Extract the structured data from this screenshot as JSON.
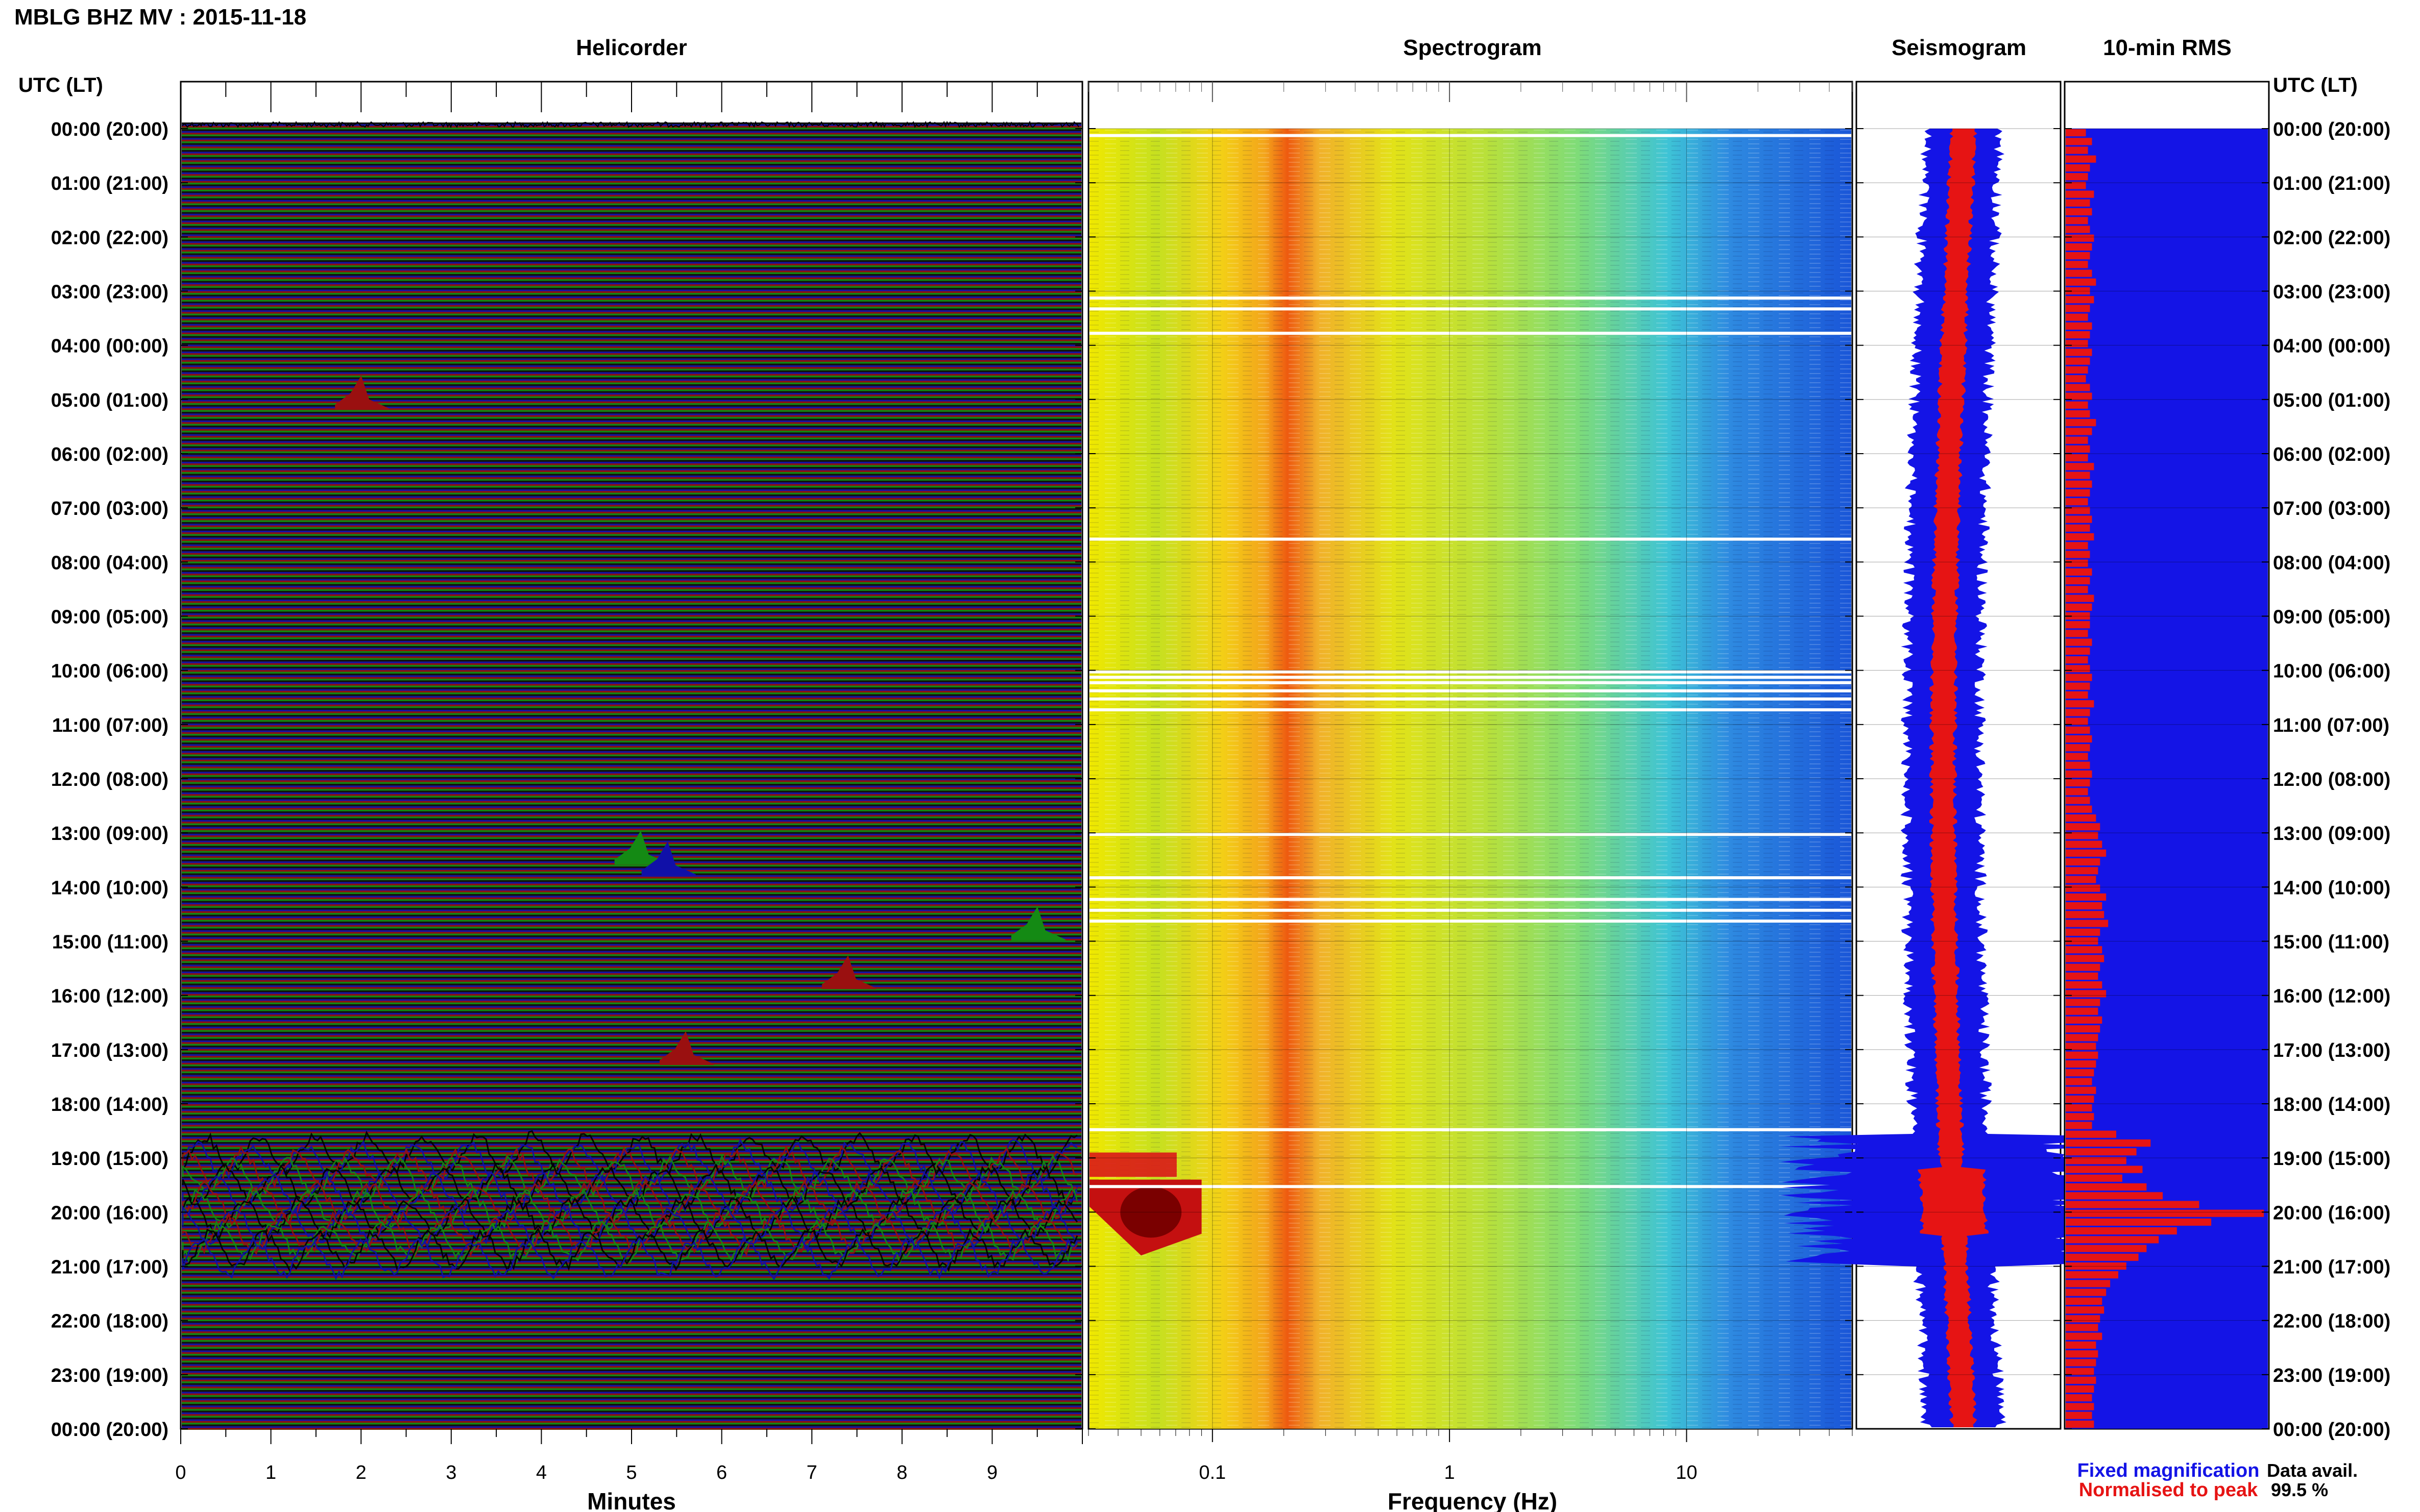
{
  "header": {
    "title": "MBLG BHZ MV : 2015-11-18",
    "axis_label_left": "UTC (LT)",
    "axis_label_right": "UTC (LT)"
  },
  "panels": {
    "helicorder": "Helicorder",
    "spectrogram": "Spectrogram",
    "seismogram": "Seismogram",
    "rms": "10-min RMS"
  },
  "time_labels": [
    "00:00 (20:00)",
    "01:00 (21:00)",
    "02:00 (22:00)",
    "03:00 (23:00)",
    "04:00 (00:00)",
    "05:00 (01:00)",
    "06:00 (02:00)",
    "07:00 (03:00)",
    "08:00 (04:00)",
    "09:00 (05:00)",
    "10:00 (06:00)",
    "11:00 (07:00)",
    "12:00 (08:00)",
    "13:00 (09:00)",
    "14:00 (10:00)",
    "15:00 (11:00)",
    "16:00 (12:00)",
    "17:00 (13:00)",
    "18:00 (14:00)",
    "19:00 (15:00)",
    "20:00 (16:00)",
    "21:00 (17:00)",
    "22:00 (18:00)",
    "23:00 (19:00)",
    "00:00 (20:00)"
  ],
  "legend": {
    "fixed": "Fixed magnification",
    "normalised": "Normalised to peak",
    "fixed_color": "#1414e6",
    "normalised_color": "#e61414"
  },
  "data_avail": {
    "label": "Data avail.",
    "value": "99.5 %"
  },
  "chart_data": [
    {
      "type": "line",
      "title": "Helicorder",
      "xlabel": "Minutes",
      "ylabel": "UTC (LT)",
      "x_ticks": [
        "0",
        "1",
        "2",
        "3",
        "4",
        "5",
        "6",
        "7",
        "8",
        "9"
      ],
      "xlim": [
        0,
        10
      ],
      "ylim_hours": [
        0,
        24
      ],
      "trace_colors": [
        "#000000",
        "#1010a8",
        "#9a1010",
        "#148a14"
      ],
      "events": [
        {
          "hour": 13.5,
          "minute": 5.1,
          "color": "#148a14"
        },
        {
          "hour": 13.7,
          "minute": 5.4,
          "color": "#1010a8"
        },
        {
          "hour": 14.9,
          "minute": 9.5,
          "color": "#148a14"
        },
        {
          "hour": 17.2,
          "minute": 5.6,
          "color": "#9a1010"
        },
        {
          "hour": 5.1,
          "minute": 2.0,
          "color": "#9a1010"
        },
        {
          "hour": 15.8,
          "minute": 7.4,
          "color": "#9a1010"
        }
      ],
      "high_amplitude_hours": [
        18.9,
        21.0
      ]
    },
    {
      "type": "heatmap",
      "title": "Spectrogram",
      "xlabel": "Frequency (Hz)",
      "x_scale": "log",
      "x_ticks": [
        "0.1",
        "1",
        "10"
      ],
      "xlim": [
        0.03,
        50
      ],
      "ylim_hours": [
        0,
        24
      ],
      "peak_frequency_hz": 0.25,
      "low_frequency_burst_hours": [
        18.9,
        20.8
      ]
    },
    {
      "type": "area",
      "title": "Seismogram",
      "series": [
        {
          "name": "Fixed magnification",
          "color": "#1414e6"
        },
        {
          "name": "Normalised to peak",
          "color": "#e61414"
        }
      ],
      "ylim_hours": [
        0,
        24
      ],
      "peak_hour": 19.8
    },
    {
      "type": "bar",
      "title": "10-min RMS",
      "ylim_hours": [
        0,
        24
      ],
      "bin_minutes": 10,
      "rms_relative": [
        0.1,
        0.13,
        0.11,
        0.15,
        0.12,
        0.11,
        0.1,
        0.14,
        0.12,
        0.13,
        0.11,
        0.12,
        0.14,
        0.13,
        0.12,
        0.11,
        0.13,
        0.15,
        0.12,
        0.14,
        0.12,
        0.11,
        0.13,
        0.12,
        0.11,
        0.13,
        0.12,
        0.11,
        0.1,
        0.12,
        0.13,
        0.11,
        0.12,
        0.15,
        0.13,
        0.11,
        0.12,
        0.11,
        0.14,
        0.12,
        0.13,
        0.12,
        0.11,
        0.12,
        0.13,
        0.12,
        0.14,
        0.11,
        0.12,
        0.11,
        0.13,
        0.12,
        0.11,
        0.14,
        0.13,
        0.12,
        0.12,
        0.11,
        0.13,
        0.12,
        0.11,
        0.12,
        0.13,
        0.12,
        0.11,
        0.14,
        0.12,
        0.11,
        0.12,
        0.13,
        0.12,
        0.11,
        0.12,
        0.13,
        0.12,
        0.11,
        0.12,
        0.13,
        0.15,
        0.17,
        0.16,
        0.18,
        0.2,
        0.17,
        0.16,
        0.15,
        0.17,
        0.2,
        0.18,
        0.19,
        0.21,
        0.17,
        0.16,
        0.18,
        0.19,
        0.17,
        0.16,
        0.18,
        0.2,
        0.17,
        0.16,
        0.18,
        0.17,
        0.16,
        0.15,
        0.16,
        0.15,
        0.14,
        0.13,
        0.15,
        0.14,
        0.13,
        0.14,
        0.13,
        0.25,
        0.42,
        0.35,
        0.3,
        0.38,
        0.28,
        0.4,
        0.48,
        0.66,
        0.98,
        0.72,
        0.55,
        0.46,
        0.4,
        0.36,
        0.3,
        0.26,
        0.22,
        0.2,
        0.18,
        0.19,
        0.17,
        0.16,
        0.18,
        0.15,
        0.16,
        0.15,
        0.14,
        0.15,
        0.14,
        0.13,
        0.14,
        0.13,
        0.14
      ]
    }
  ]
}
